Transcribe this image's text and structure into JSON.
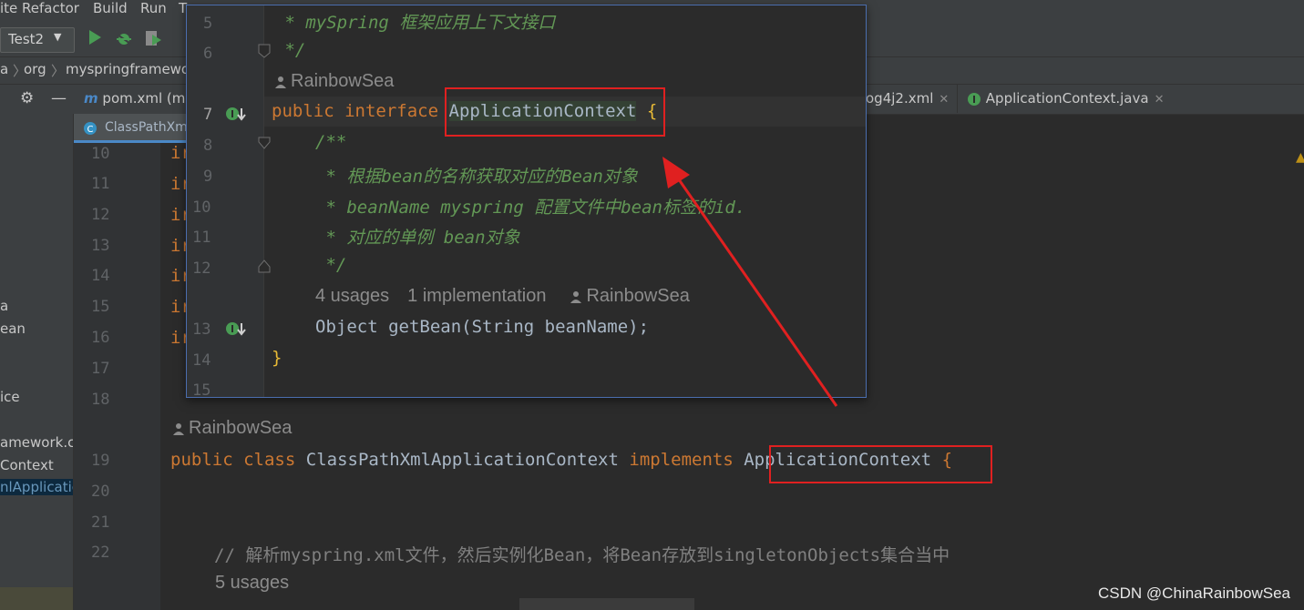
{
  "menu": [
    "ite",
    "Refactor",
    "Build",
    "Run",
    "T"
  ],
  "toolbar": {
    "run_config": "Test2"
  },
  "breadcrumb": [
    "a",
    "org",
    "myspringframewo"
  ],
  "editor_tabs": [
    {
      "label": "pom.xml (m"
    },
    {
      "label": "og4j2.xml"
    },
    {
      "label": "ApplicationContext.java"
    }
  ],
  "current_tab": "ClassPathXml",
  "project_tree": [
    "a",
    "ean",
    "ice",
    "amework.c",
    "Context",
    "nlApplicatic"
  ],
  "popup": {
    "lines": [
      "5",
      "6",
      "7",
      "8",
      "9",
      "10",
      "11",
      "12",
      "13",
      "14",
      "15"
    ],
    "comment_title": " * mySpring 框架应用上下文接口",
    "comment_end": " */",
    "author": "RainbowSea",
    "kw_public": "public",
    "kw_interface": "interface",
    "interface_name": "ApplicationContext",
    "brace_open": "{",
    "doc_open": "/**",
    "doc_1": " * 根据bean的名称获取对应的Bean对象",
    "doc_2": " * beanName myspring 配置文件中bean标签的id.",
    "doc_3": " * 对应的单例 bean对象",
    "doc_end": " */",
    "usages": "4 usages",
    "implementations": "1 implementation",
    "method_author": "RainbowSea",
    "method_sig": "Object getBean(String beanName);",
    "brace_close": "}"
  },
  "editor": {
    "lines": [
      "10",
      "11",
      "12",
      "13",
      "14",
      "15",
      "16",
      "17",
      "18",
      "19",
      "20",
      "21",
      "22"
    ],
    "import_fragment": "ir",
    "class_author": "RainbowSea",
    "kw_public": "public",
    "kw_class": "class",
    "class_name": "ClassPathXmlApplicationContext",
    "kw_implements": "implements",
    "implemented": "ApplicationContext",
    "brace": "{",
    "line_comment": "// 解析myspring.xml文件，然后实例化Bean，将Bean存放到singletonObjects集合当中",
    "field_usages": "5 usages"
  },
  "watermark": "CSDN @ChinaRainbowSea",
  "colors": {
    "annotation_red": "#e02020",
    "keyword": "#cc7832",
    "doc_comment": "#629755",
    "popup_border": "#4b6eaf"
  }
}
